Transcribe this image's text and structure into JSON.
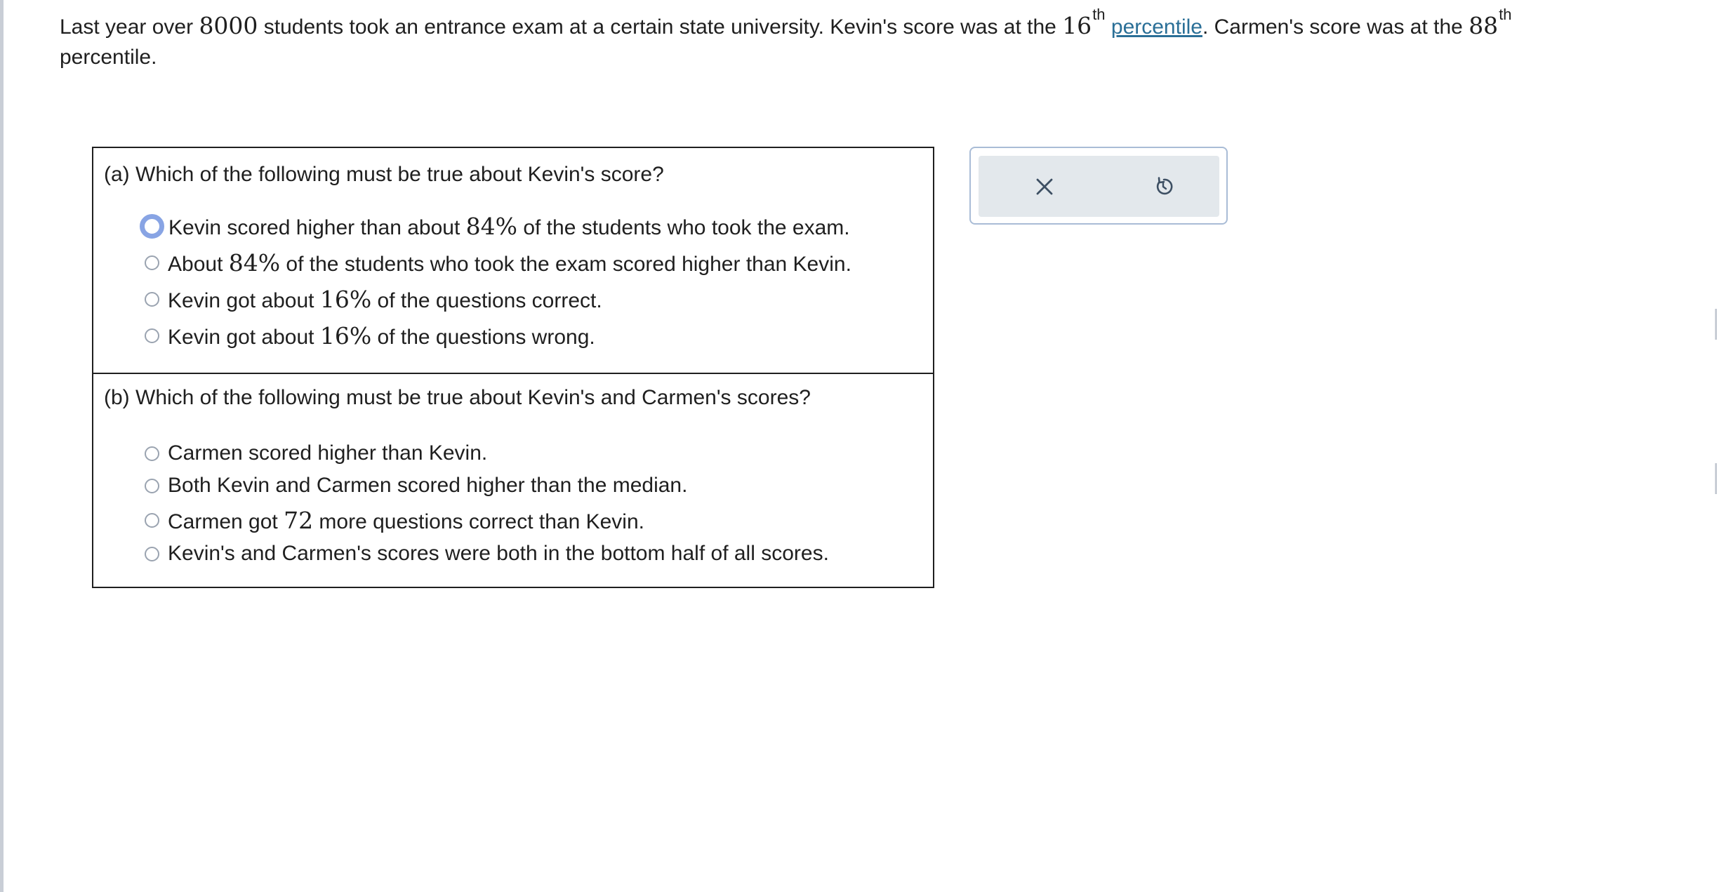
{
  "problem": {
    "text_1": "Last year over ",
    "students_count": "8000",
    "text_2": " students took an entrance exam at a certain state university. Kevin's score was at the ",
    "kevin_percentile": "16",
    "kevin_suffix": "th",
    "link_text": "percentile",
    "text_3": ". Carmen's score was at the ",
    "carmen_percentile": "88",
    "carmen_suffix": "th",
    "text_4": "percentile."
  },
  "part_a": {
    "prompt": "(a) Which of the following must be true about Kevin's score?",
    "options": [
      {
        "before": "Kevin scored higher than about ",
        "num": "84%",
        "after": " of the students who took the exam.",
        "state": "focused"
      },
      {
        "before": "About ",
        "num": "84%",
        "after": " of the students who took the exam scored higher than Kevin.",
        "state": "unselected"
      },
      {
        "before": "Kevin got about ",
        "num": "16%",
        "after": " of the questions correct.",
        "state": "unselected"
      },
      {
        "before": "Kevin got about ",
        "num": "16%",
        "after": " of the questions wrong.",
        "state": "unselected"
      }
    ]
  },
  "part_b": {
    "prompt": "(b) Which of the following must be true about Kevin's and Carmen's scores?",
    "options": [
      {
        "before": "Carmen scored higher than Kevin.",
        "num": "",
        "after": "",
        "state": "unselected"
      },
      {
        "before": "Both Kevin and Carmen scored higher than the median.",
        "num": "",
        "after": "",
        "state": "unselected"
      },
      {
        "before": "Carmen got ",
        "num": "72",
        "after": " more questions correct than Kevin.",
        "state": "unselected"
      },
      {
        "before": "Kevin's and Carmen's scores were both in the bottom half of all scores.",
        "num": "",
        "after": "",
        "state": "unselected"
      }
    ]
  },
  "toolbar": {
    "clear_icon": "x-icon",
    "reset_icon": "undo-icon"
  },
  "colors": {
    "link": "#2a6f97",
    "radio_focus": "#88a4e4",
    "toolbar_bg": "#e3e8ec",
    "toolbar_border": "#a9bcd6"
  }
}
